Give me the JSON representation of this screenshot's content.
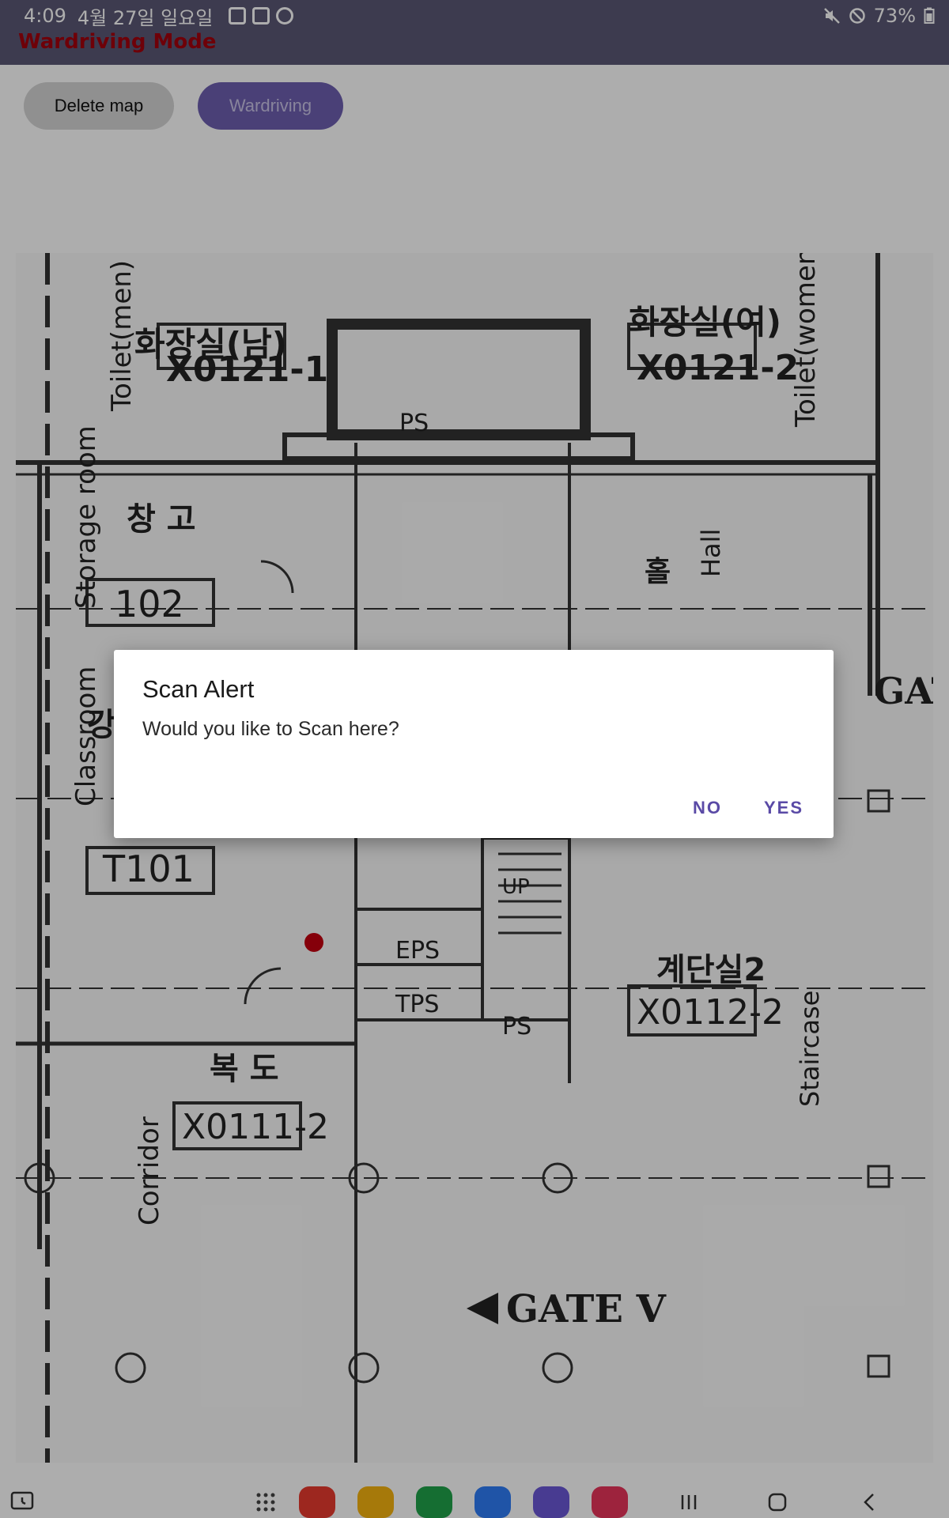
{
  "status_bar": {
    "time": "4:09",
    "date": "4월 27일 일요일",
    "battery": "73%",
    "left_icons": [
      "gallery-icon",
      "contact-card-icon",
      "sync-icon"
    ],
    "right_icons": [
      "mute-icon",
      "do-not-disturb-icon",
      "battery-icon"
    ]
  },
  "app": {
    "title": "Wardriving Mode",
    "title_color": "#a3000d",
    "bar_color": "#5b5775"
  },
  "toolbar": {
    "delete_label": "Delete map",
    "wardriving_label": "Wardriving"
  },
  "floorplan": {
    "labels": {
      "toilet_men": "Toilet(men)",
      "toilet_men_kr": "화장실(남)",
      "toilet_men_code": "X0121-1",
      "toilet_women": "Toilet(women)",
      "toilet_women_kr": "화장실(여)",
      "toilet_women_code": "X0121-2",
      "ps_top": "PS",
      "storage_room": "Storage room",
      "storage_kr": "창 고",
      "storage_code": "102",
      "hall": "Hall",
      "hall_kr": "홀",
      "classroom": "Classroom",
      "classroom_kr": "강",
      "classroom_code": "T101",
      "gate_right": "GAT",
      "eps": "EPS",
      "tps": "TPS",
      "ps_bottom": "PS",
      "up": "UP",
      "staircase_kr": "계단실2",
      "staircase_code": "X0112-2",
      "staircase": "Staircase",
      "corridor": "Corridor",
      "corridor_kr": "복 도",
      "corridor_code": "X0111-2",
      "gate_bottom": "GATE   V"
    }
  },
  "dialog": {
    "title": "Scan Alert",
    "message": "Would you like to Scan here?",
    "no_label": "NO",
    "yes_label": "YES"
  },
  "nav_bar": {
    "apps": [
      {
        "name": "apps-grid-icon",
        "color": "#444444"
      },
      {
        "name": "notes-app-icon",
        "color": "#e83a2f"
      },
      {
        "name": "files-app-icon",
        "color": "#f5b30f"
      },
      {
        "name": "phone-app-icon",
        "color": "#1fa24a"
      },
      {
        "name": "messages-app-icon",
        "color": "#2f7cf6"
      },
      {
        "name": "browser-app-icon",
        "color": "#6b57d6"
      },
      {
        "name": "camera-app-icon",
        "color": "#e8345a"
      }
    ]
  }
}
